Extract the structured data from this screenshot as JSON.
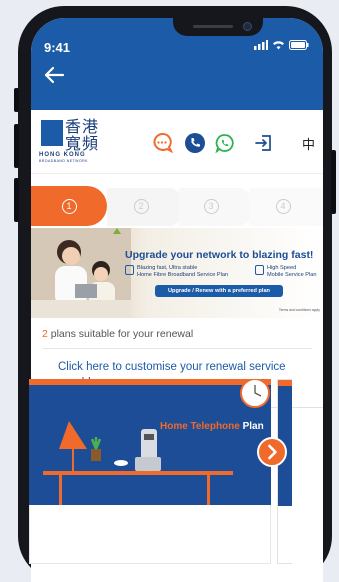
{
  "status_bar": {
    "time": "9:41"
  },
  "header": {
    "lang_label": "中"
  },
  "logo": {
    "chinese": "香港寬頻",
    "english": "HONG KONG",
    "sub": "BROADBAND NETWORK"
  },
  "steps": [
    {
      "label": "1"
    },
    {
      "label": "2"
    },
    {
      "label": "3"
    },
    {
      "label": "4"
    }
  ],
  "banner": {
    "headline": "Upgrade your network to blazing fast!",
    "feature1_line1": "Blazing fast, Ultra stable",
    "feature1_line2": "Home Fibre Broadband Service Plan",
    "feature2_line1": "High Speed",
    "feature2_line2": "Mobile Service Plan",
    "cta_label": "Upgrade / Renew with a preferred plan",
    "terms": "Terms and conditions apply"
  },
  "plans": {
    "count": "2",
    "suffix": " plans suitable for your renewal"
  },
  "customise_link": "Click here to customise your renewal service or address",
  "plan_card": {
    "title_orange": "Home Telephone",
    "title_white": " Plan"
  },
  "colors": {
    "brand_blue": "#1c5ba8",
    "accent_orange": "#ef6a2b"
  }
}
